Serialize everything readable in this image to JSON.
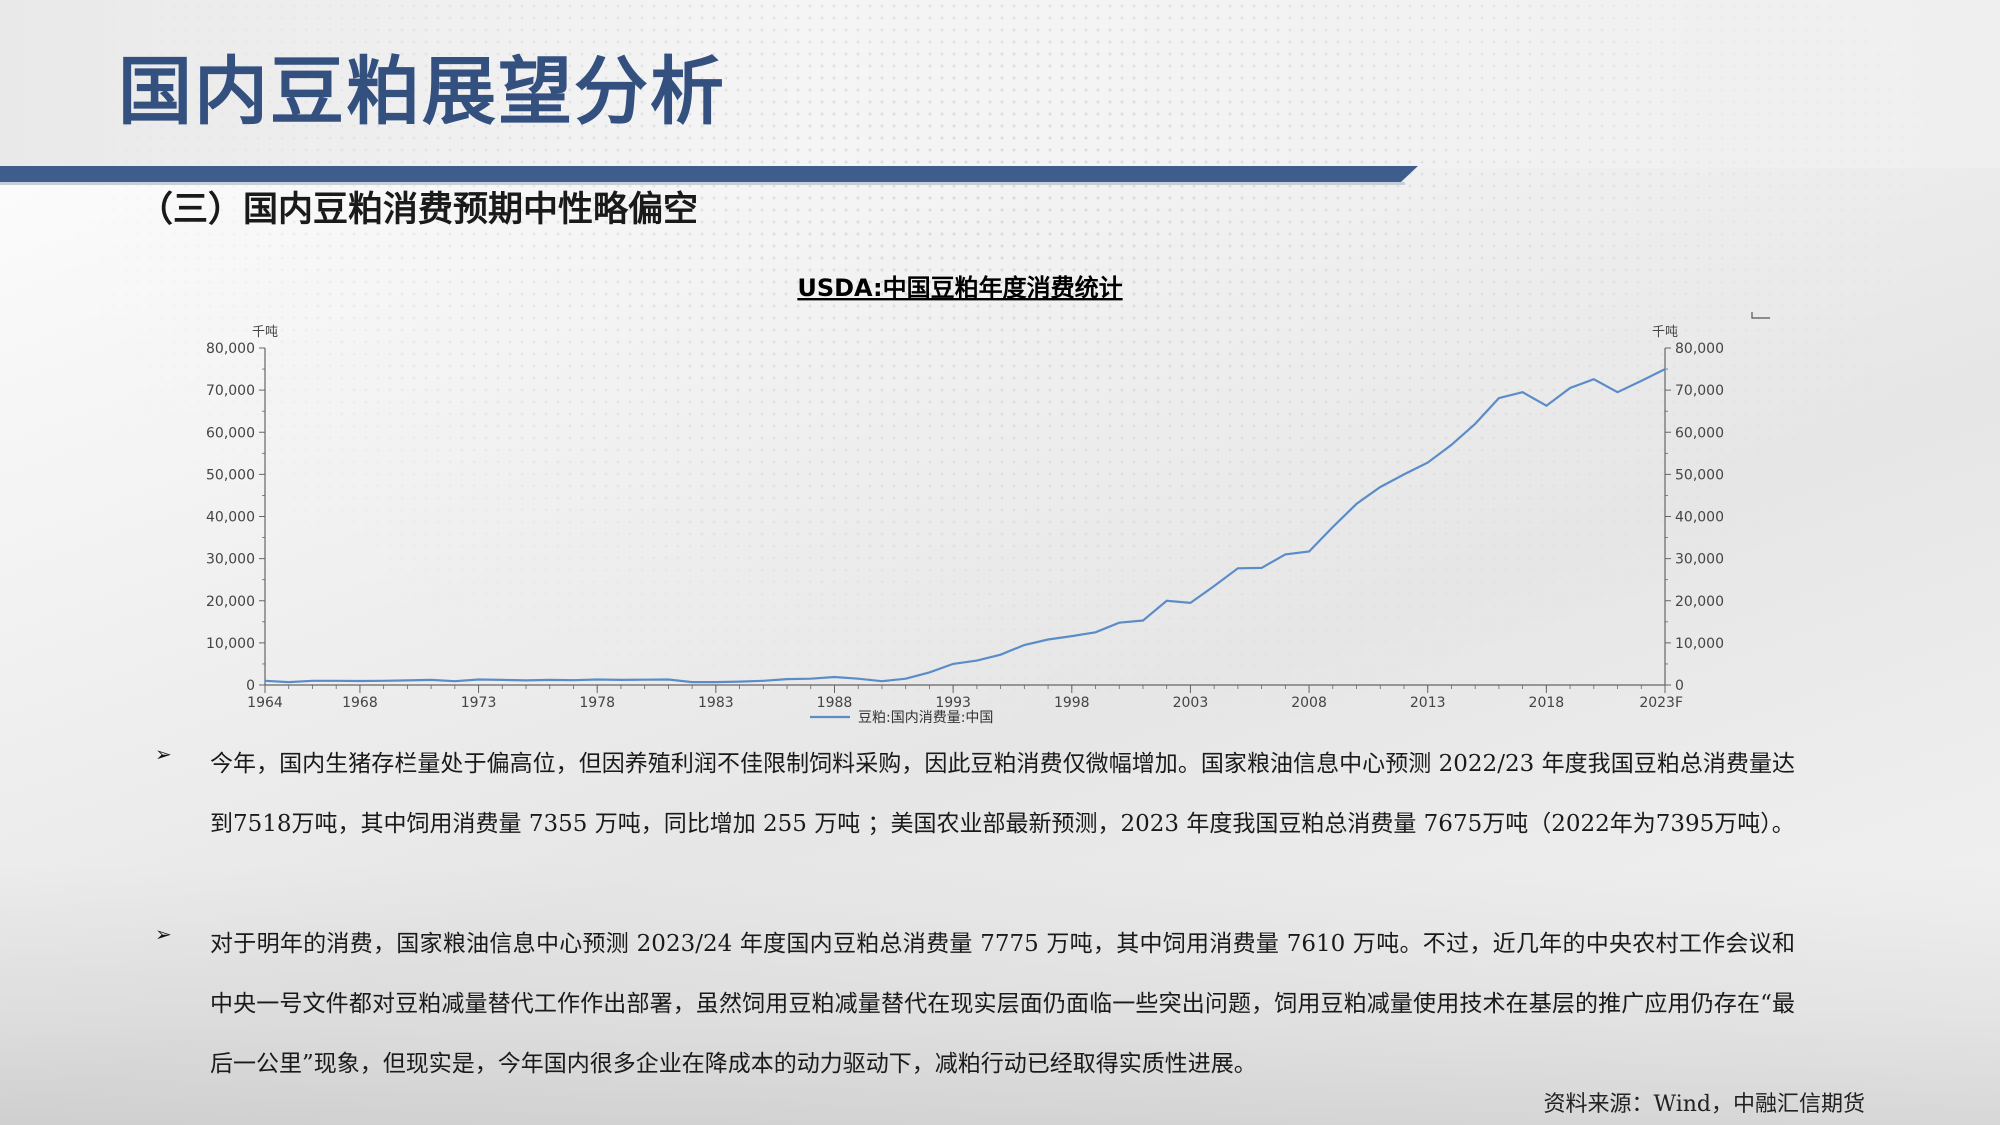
{
  "page": {
    "title": "国内豆粕展望分析",
    "subtitle": "（三）国内豆粕消费预期中性略偏空"
  },
  "chart_data": {
    "type": "line",
    "title": "USDA:中国豆粕年度消费统计",
    "ylabel_left": "千吨",
    "ylabel_right": "千吨",
    "ylim": [
      0,
      80000
    ],
    "y_ticks": [
      "0",
      "10,000",
      "20,000",
      "30,000",
      "40,000",
      "50,000",
      "60,000",
      "70,000",
      "80,000"
    ],
    "x_ticks": [
      "1964",
      "1968",
      "1973",
      "1978",
      "1983",
      "1988",
      "1993",
      "1998",
      "2003",
      "2008",
      "2013",
      "2018",
      "2023F"
    ],
    "legend": "豆粕:国内消费量:中国",
    "legend_position": "bottom",
    "grid": false,
    "line_color": "#5b8cc8",
    "series": [
      {
        "name": "豆粕:国内消费量:中国",
        "x": [
          1964,
          1965,
          1966,
          1967,
          1968,
          1969,
          1970,
          1971,
          1972,
          1973,
          1974,
          1975,
          1976,
          1977,
          1978,
          1979,
          1980,
          1981,
          1982,
          1983,
          1984,
          1985,
          1986,
          1987,
          1988,
          1989,
          1990,
          1991,
          1992,
          1993,
          1994,
          1995,
          1996,
          1997,
          1998,
          1999,
          2000,
          2001,
          2002,
          2003,
          2004,
          2005,
          2006,
          2007,
          2008,
          2009,
          2010,
          2011,
          2012,
          2013,
          2014,
          2015,
          2016,
          2017,
          2018,
          2019,
          2020,
          2021,
          2022,
          2023
        ],
        "values": [
          1000,
          700,
          1000,
          1000,
          950,
          1000,
          1100,
          1200,
          900,
          1300,
          1200,
          1100,
          1200,
          1150,
          1300,
          1200,
          1250,
          1300,
          700,
          700,
          800,
          1000,
          1400,
          1500,
          1900,
          1500,
          900,
          1500,
          3000,
          5000,
          5800,
          7200,
          9500,
          10800,
          11600,
          12500,
          14800,
          15300,
          20000,
          19500,
          23500,
          27700,
          27800,
          31000,
          31700,
          37500,
          43000,
          47000,
          50000,
          52800,
          57000,
          62000,
          68100,
          69500,
          66300,
          70500,
          72600,
          69500,
          72200,
          75000
        ]
      }
    ]
  },
  "bullets": [
    {
      "marker": "➢",
      "text": "今年，国内生猪存栏量处于偏高位，但因养殖利润不佳限制饲料采购，因此豆粕消费仅微幅增加。国家粮油信息中心预测 2022/23 年度我国豆粕总消费量达到7518万吨，其中饲用消费量 7355 万吨，同比增加 255 万吨 ；美国农业部最新预测，2023 年度我国豆粕总消费量 7675万吨（2022年为7395万吨）。"
    },
    {
      "marker": "➢",
      "text": "对于明年的消费，国家粮油信息中心预测 2023/24 年度国内豆粕总消费量 7775 万吨，其中饲用消费量 7610 万吨。不过，近几年的中央农村工作会议和中央一号文件都对豆粕减量替代工作作出部署，虽然饲用豆粕减量替代在现实层面仍面临一些突出问题，饲用豆粕减量使用技术在基层的推广应用仍存在“最后一公里”现象，但现实是，今年国内很多企业在降成本的动力驱动下，减粕行动已经取得实质性进展。"
    }
  ],
  "source": "资料来源：Wind，中融汇信期货"
}
